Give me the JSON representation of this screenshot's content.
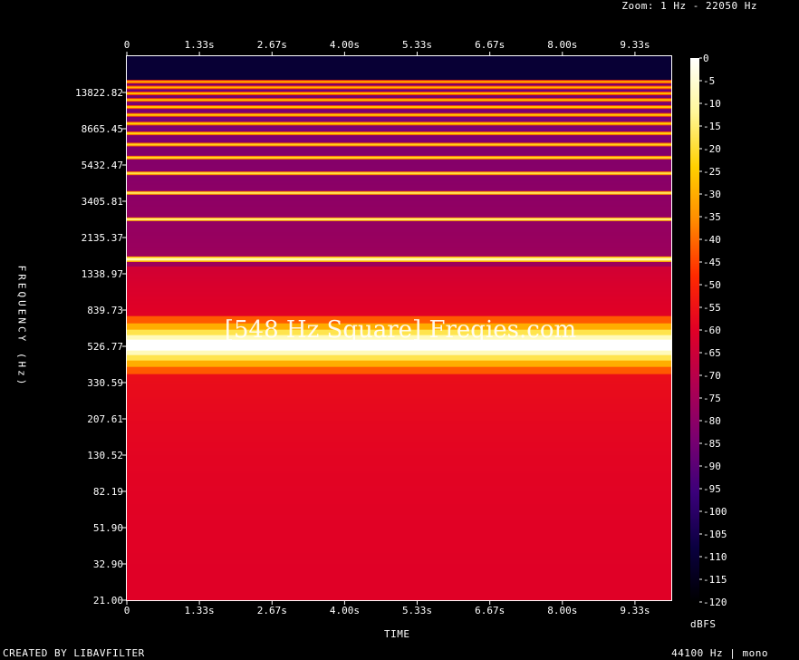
{
  "header": {
    "zoom": "Zoom: 1 Hz - 22050 Hz"
  },
  "footer": {
    "created": "CREATED BY LIBAVFILTER",
    "format": "44100 Hz | mono"
  },
  "colorbar": {
    "unit": "dBFS",
    "labels": [
      "0",
      "-5",
      "-10",
      "-15",
      "-20",
      "-25",
      "-30",
      "-35",
      "-40",
      "-45",
      "-50",
      "-55",
      "-60",
      "-65",
      "-70",
      "-75",
      "-80",
      "-85",
      "-90",
      "-95",
      "-100",
      "-105",
      "-110",
      "-115",
      "-120"
    ]
  },
  "chart_data": {
    "type": "heatmap",
    "title": "[548 Hz Square] Freqies.com",
    "xlabel": "TIME",
    "ylabel": "FREQUENCY (Hz)",
    "x_ticks": [
      "0",
      "1.33s",
      "2.67s",
      "4.00s",
      "5.33s",
      "6.67s",
      "8.00s",
      "9.33s"
    ],
    "x_tick_values": [
      0,
      1.333,
      2.667,
      4.0,
      5.333,
      6.667,
      8.0,
      9.333
    ],
    "xlim": [
      0,
      10
    ],
    "y_ticks": [
      "21.00",
      "32.90",
      "51.90",
      "82.19",
      "130.52",
      "207.61",
      "330.59",
      "526.77",
      "839.73",
      "1338.97",
      "2135.37",
      "3405.81",
      "5432.47",
      "8665.45",
      "13822.82"
    ],
    "ylim": [
      21,
      22050
    ],
    "y_scale": "log",
    "zlim": [
      -120,
      0
    ],
    "harmonics_hz": [
      548,
      1644,
      2740,
      3836,
      4932,
      6028,
      7124,
      8220,
      9316,
      10412,
      11508,
      12604,
      13700,
      14796,
      15892
    ],
    "harmonic_levels_dbfs": [
      0,
      -10,
      -14,
      -17,
      -19,
      -21,
      -22,
      -23,
      -24,
      -25,
      -26,
      -27,
      -28,
      -29,
      -30
    ],
    "grid": false
  }
}
